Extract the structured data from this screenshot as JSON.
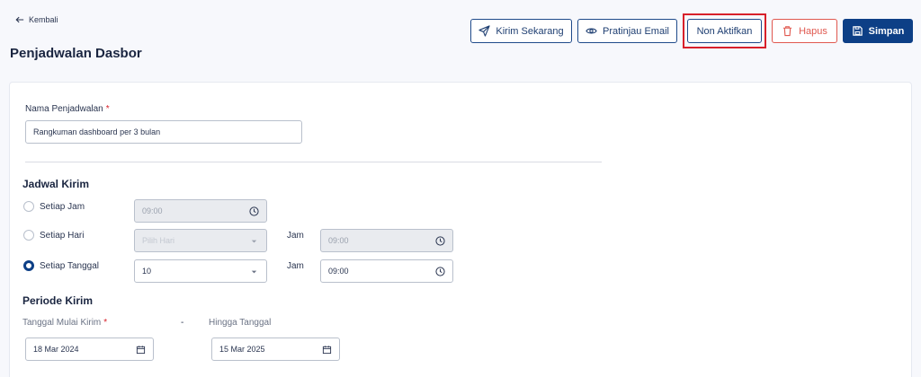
{
  "nav": {
    "back_label": "Kembali"
  },
  "page": {
    "title": "Penjadwalan Dasbor"
  },
  "toolbar": {
    "send_now": "Kirim Sekarang",
    "preview_email": "Pratinjau Email",
    "deactivate": "Non Aktifkan",
    "delete": "Hapus",
    "save": "Simpan"
  },
  "form": {
    "schedule_name": {
      "label": "Nama Penjadwalan",
      "required": "*",
      "value": "Rangkuman dashboard per 3 bulan"
    },
    "send_schedule": {
      "title": "Jadwal Kirim",
      "options": [
        {
          "label": "Setiap Jam",
          "selected": false,
          "time": "09:00"
        },
        {
          "label": "Setiap Hari",
          "selected": false,
          "day_placeholder": "Pilih Hari",
          "time_label": "Jam",
          "time": "09:00"
        },
        {
          "label": "Setiap Tanggal",
          "selected": true,
          "date_value": "10",
          "time_label": "Jam",
          "time": "09:00"
        }
      ]
    },
    "send_period": {
      "title": "Periode Kirim",
      "start_label": "Tanggal Mulai Kirim",
      "required": "*",
      "separator": "-",
      "end_label": "Hingga Tanggal",
      "start_value": "18 Mar 2024",
      "end_value": "15 Mar 2025"
    }
  },
  "colors": {
    "primary": "#0d3f86",
    "danger": "#e0584f",
    "highlight": "#d8202a"
  }
}
